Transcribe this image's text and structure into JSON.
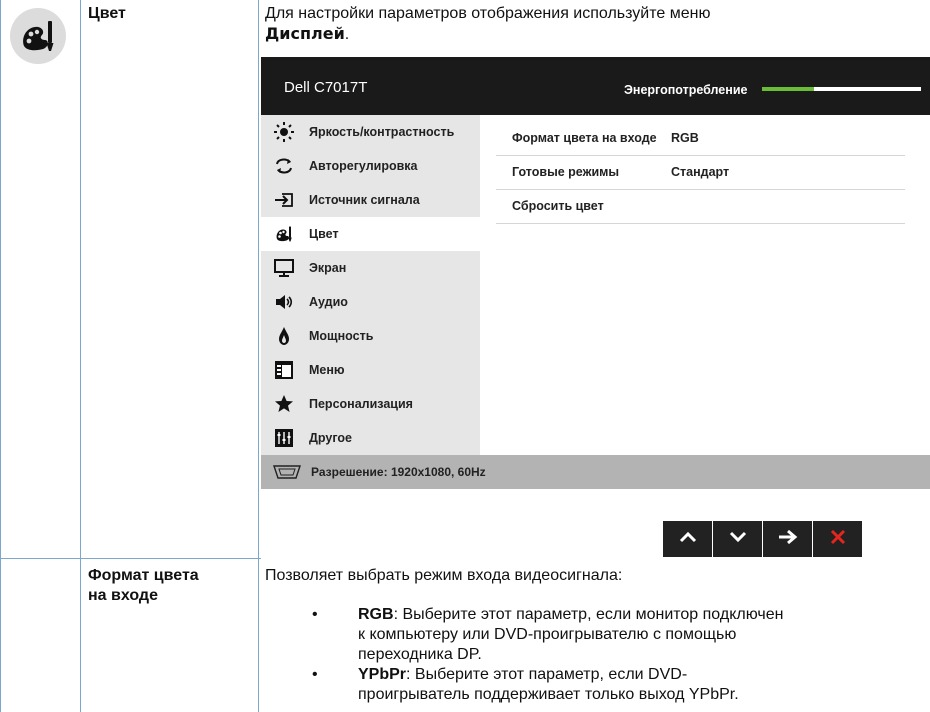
{
  "section": {
    "label": "Цвет",
    "intro": "Для настройки параметров отображения используйте меню",
    "intro_menu": "Дисплей",
    "intro_end": "."
  },
  "osd": {
    "title": "Dell C7017T",
    "power_label": "Энергопотребление",
    "power_level": 0.33,
    "menu": [
      {
        "label": "Яркость/контрастность",
        "icon": "brightness-icon"
      },
      {
        "label": "Авторегулировка",
        "icon": "auto-adjust-icon"
      },
      {
        "label": "Источник сигнала",
        "icon": "input-source-icon"
      },
      {
        "label": "Цвет",
        "icon": "color-icon",
        "active": true
      },
      {
        "label": "Экран",
        "icon": "display-icon"
      },
      {
        "label": "Аудио",
        "icon": "audio-icon"
      },
      {
        "label": "Мощность",
        "icon": "power-icon"
      },
      {
        "label": "Меню",
        "icon": "menu-icon"
      },
      {
        "label": "Персонализация",
        "icon": "star-icon"
      },
      {
        "label": "Другое",
        "icon": "other-icon"
      }
    ],
    "submenu": [
      {
        "label": "Формат цвета на входе",
        "value": "RGB"
      },
      {
        "label": "Готовые режимы",
        "value": "Стандарт"
      },
      {
        "label": "Сбросить цвет",
        "value": ""
      }
    ],
    "status": "Разрешение: 1920x1080, 60Hz",
    "nav": [
      "up-arrow-icon",
      "down-arrow-icon",
      "right-arrow-icon",
      "close-icon"
    ],
    "colors": {
      "header": "#1a1a1a",
      "menu_bg": "#e6e6e6",
      "accent": "#6abe36",
      "close": "#e5261e"
    }
  },
  "format": {
    "label_line1": "Формат цвета",
    "label_line2": "на входе",
    "intro": "Позволяет выбрать режим входа видеосигнала:",
    "items": [
      {
        "term": "RGB",
        "text_line1": ": Выберите этот параметр, если монитор подключен",
        "text_line2": "к компьютеру или DVD-проигрывателю с помощью",
        "text_line3": "переходника DP."
      },
      {
        "term": "YPbPr",
        "text_line1": ": Выберите этот параметр, если DVD-",
        "text_line2": "проигрыватель поддерживает только выход YPbPr.",
        "text_line3": ""
      }
    ],
    "bullet": "•"
  }
}
